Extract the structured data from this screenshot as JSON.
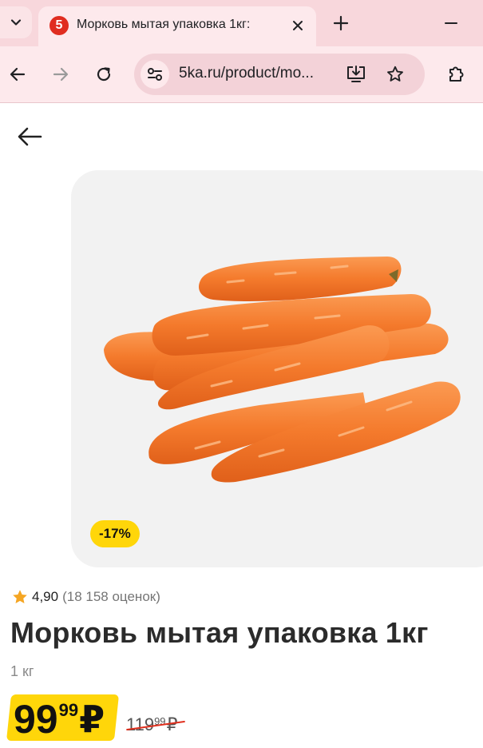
{
  "browser": {
    "tab": {
      "favicon_text": "5",
      "title": "Морковь мытая упаковка 1кг: "
    },
    "omnibox": {
      "url": "5ka.ru/product/mo..."
    },
    "colors": {
      "chrome_bg": "#f8d7dc",
      "toolbar_bg": "#fde9ec",
      "omnibox_bg": "#f3d2d8"
    }
  },
  "product": {
    "discount_badge": "-17%",
    "rating": {
      "value": "4,90",
      "count": "(18 158 оценок)"
    },
    "title": "Морковь мытая упаковка 1кг",
    "weight": "1 кг",
    "price": {
      "integer": "99",
      "cents": "99",
      "currency": "₽"
    },
    "old_price": {
      "integer": "119",
      "cents": "99",
      "currency": "₽"
    },
    "colors": {
      "accent_yellow": "#ffd60a",
      "card_bg": "#f2f2f2",
      "strike_red": "#e0301e"
    }
  }
}
